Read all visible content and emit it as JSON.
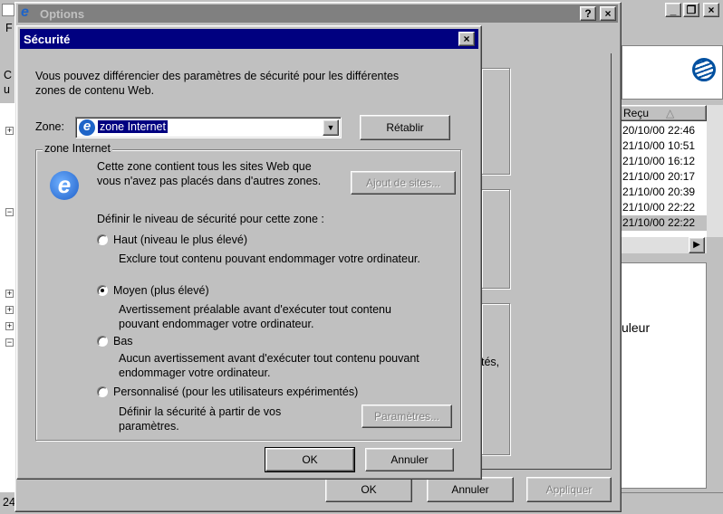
{
  "background_app": {
    "menu_letter": "F",
    "left_labels": [
      "C",
      "u"
    ],
    "tree_numbers": [
      "24"
    ],
    "right_column_header": "Reçu",
    "right_rows": [
      "20/10/00 22:46",
      "21/10/00 10:51",
      "21/10/00 16:12",
      "21/10/00 20:17",
      "21/10/00 20:39",
      "21/10/00 22:22",
      "21/10/00 22:22"
    ],
    "partial_text_1": "uleur",
    "partial_text_2": "tés,"
  },
  "options_window": {
    "title": "Options",
    "help_button": "?",
    "close_button": "×",
    "ok_label": "OK",
    "cancel_label": "Annuler",
    "apply_label": "Appliquer"
  },
  "security_dialog": {
    "title": "Sécurité",
    "intro_line1": "Vous pouvez différencier des paramètres de sécurité pour les différentes",
    "intro_line2": "zones de contenu Web.",
    "zone_label": "Zone:",
    "zone_value": "zone Internet",
    "reset_button": "Rétablir",
    "group_label": "zone Internet",
    "zone_desc_line1": "Cette zone contient tous les sites Web que",
    "zone_desc_line2": "vous n'avez pas placés dans d'autres zones.",
    "add_sites_button": "Ajout de sites...",
    "level_prompt": "Définir le niveau de sécurité pour cette zone :",
    "options": [
      {
        "label": "Haut (niveau le plus élevé)",
        "desc1": "Exclure tout contenu pouvant endommager votre ordinateur.",
        "desc2": "",
        "selected": false
      },
      {
        "label": "Moyen (plus élevé)",
        "desc1": "Avertissement préalable avant d'exécuter tout contenu",
        "desc2": "pouvant endommager votre ordinateur.",
        "selected": true
      },
      {
        "label": "Bas",
        "desc1": "Aucun avertissement avant d'exécuter tout contenu pouvant",
        "desc2": "endommager votre ordinateur.",
        "selected": false
      },
      {
        "label": "Personnalisé (pour les utilisateurs expérimentés)",
        "desc1": "Définir la sécurité à partir de vos",
        "desc2": "paramètres.",
        "selected": false
      }
    ],
    "settings_button": "Paramètres...",
    "ok_label": "OK",
    "cancel_label": "Annuler",
    "close_button": "×"
  },
  "colors": {
    "active_title": "#000080",
    "inactive_title": "#808080",
    "face": "#c0c0c0"
  }
}
